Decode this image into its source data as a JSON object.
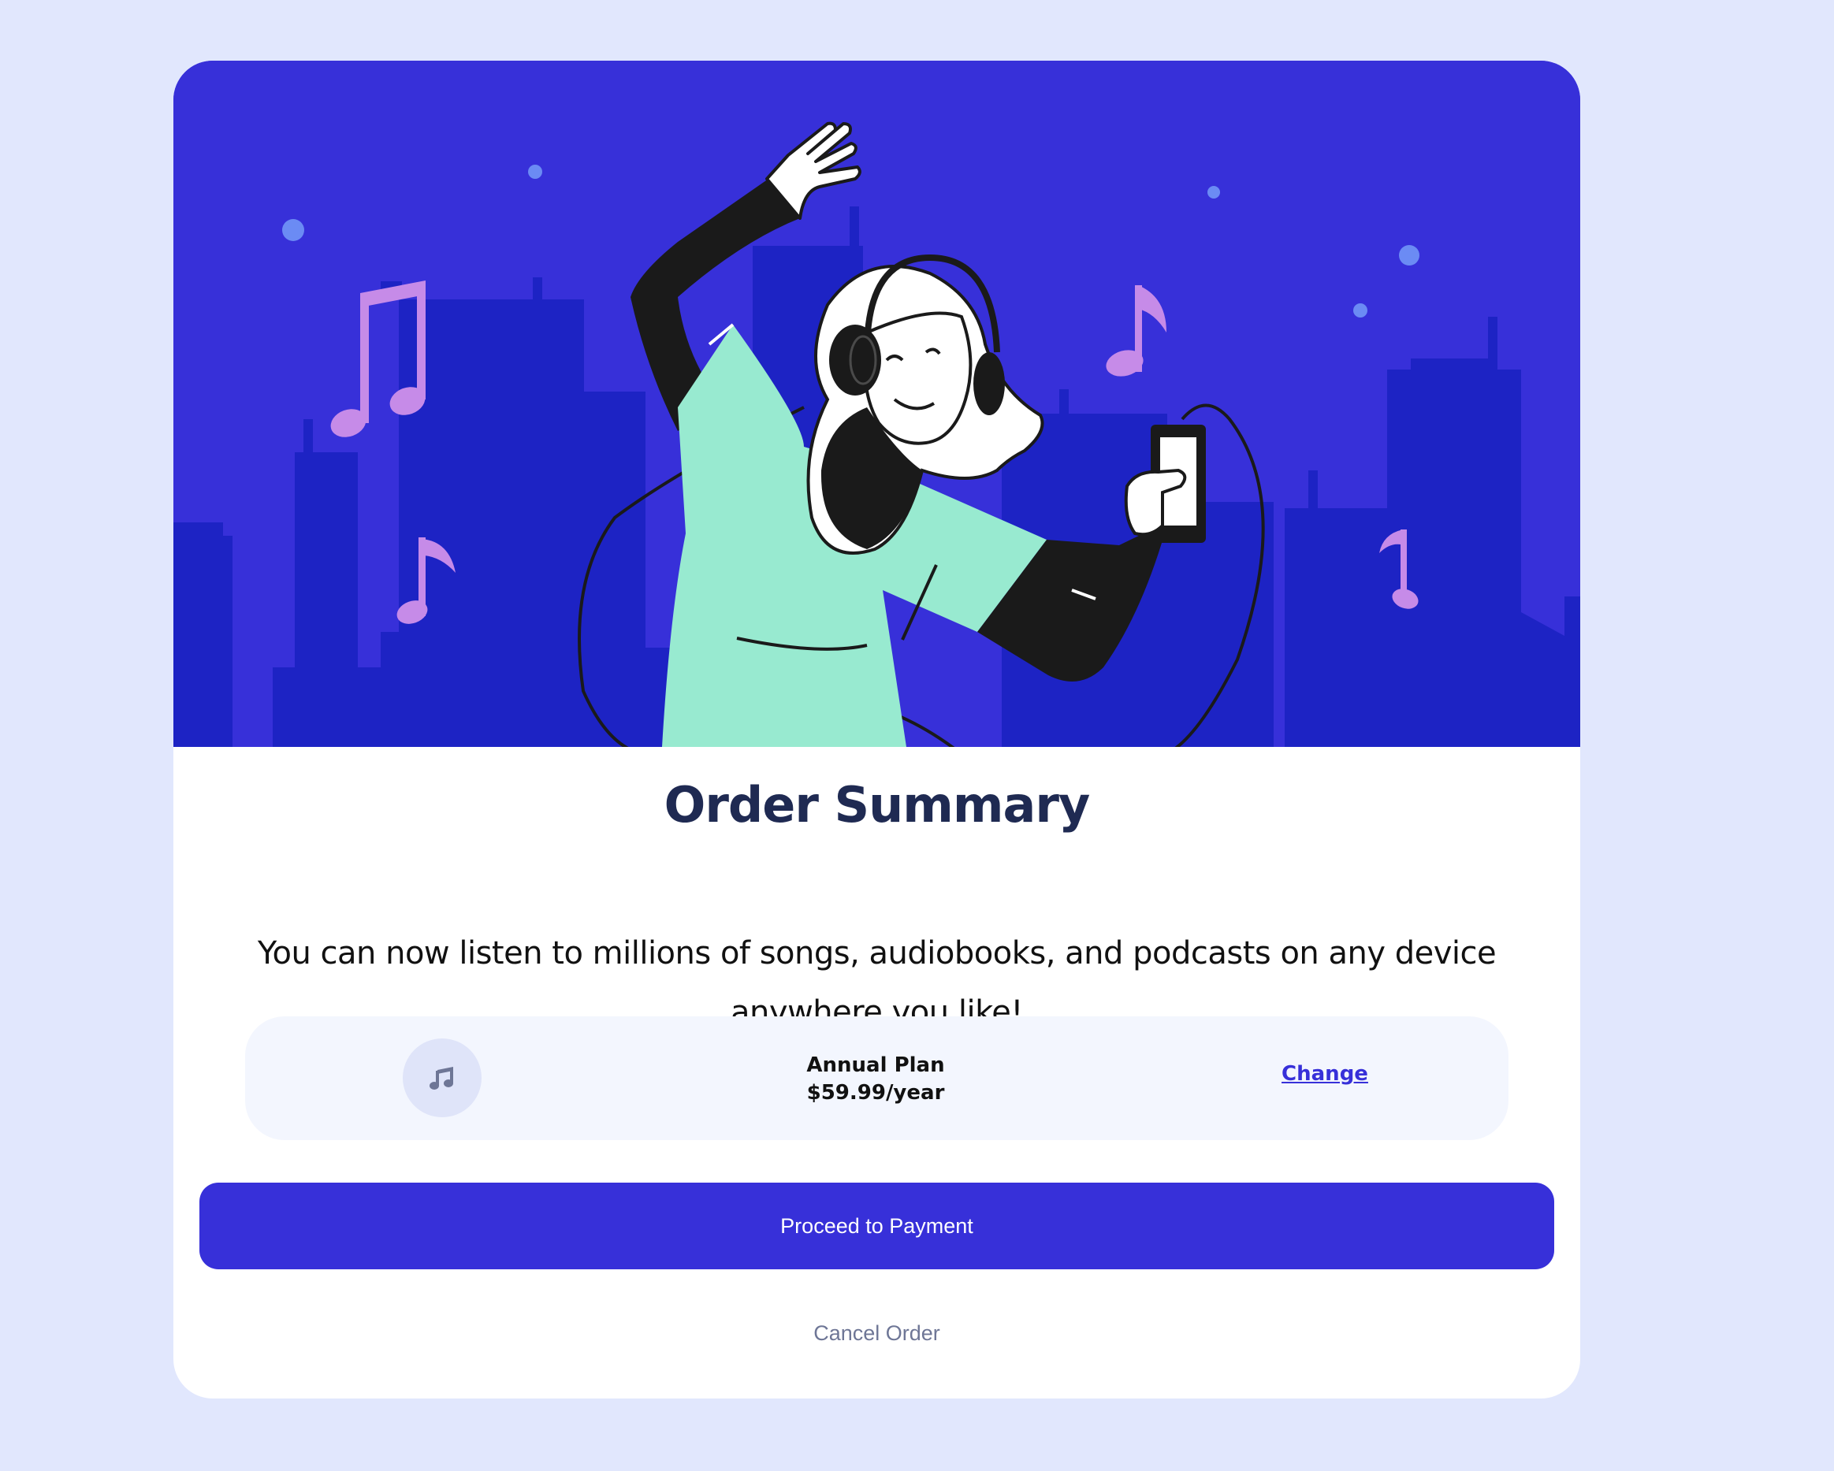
{
  "colors": {
    "page_background": "#e1e7fd",
    "accent": "#3730d9",
    "city_silhouette": "#1d23c4",
    "shirt": "#98ead0",
    "music_note": "#c68be8",
    "dot": "#6b8bf4",
    "title": "#1f2a52",
    "plan_panel": "#f3f6fe",
    "cancel_text": "#6e7696"
  },
  "hero": {
    "illustration": "woman-dancing-with-headphones-illustration"
  },
  "summary": {
    "title": "Order Summary",
    "description": "You can now listen to millions of songs, audiobooks, and podcasts on any device anywhere you like!"
  },
  "plan": {
    "icon": "music-note-icon",
    "name": "Annual Plan",
    "price": "$59.99/year",
    "change_label": "Change"
  },
  "actions": {
    "proceed_label": "Proceed to Payment",
    "cancel_label": "Cancel Order"
  }
}
